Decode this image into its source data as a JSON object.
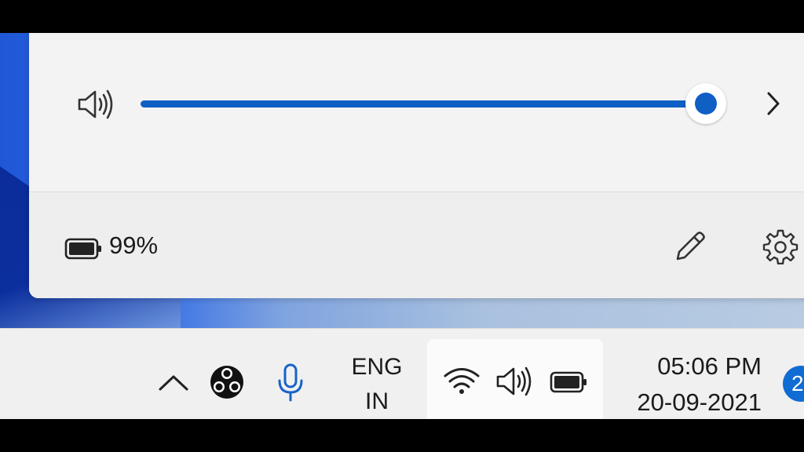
{
  "flyout": {
    "volume": {
      "level": 1.0,
      "icon": "speaker-volume-icon",
      "expand_icon": "chevron-right-icon"
    },
    "battery": {
      "icon": "battery-icon",
      "percent_label": "99%"
    },
    "edit_icon": "pencil-icon",
    "settings_icon": "gear-icon",
    "accent_color": "#0f5fc4"
  },
  "taskbar": {
    "overflow_icon": "chevron-up-icon",
    "obs_icon": "obs-studio-icon",
    "mic_icon": "microphone-icon",
    "language": {
      "line1": "ENG",
      "line2": "IN"
    },
    "tray": {
      "wifi_icon": "wifi-icon",
      "volume_icon": "speaker-volume-icon",
      "battery_icon": "battery-icon"
    },
    "clock": {
      "time": "05:06 PM",
      "date": "20-09-2021"
    },
    "notification_count": "2"
  }
}
